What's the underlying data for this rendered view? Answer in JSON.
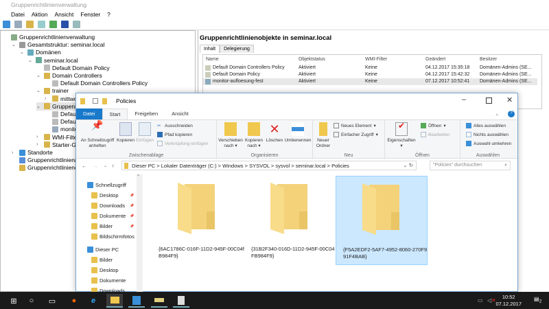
{
  "mmc": {
    "title": "Gruppenrichtlinienverwaltung",
    "menu": [
      "Datei",
      "Aktion",
      "Ansicht",
      "Fenster",
      "?"
    ],
    "tree": [
      {
        "label": "Gruppenrichtlinienverwaltung",
        "level": 0
      },
      {
        "label": "Gesamtstruktur: seminar.local",
        "level": 1
      },
      {
        "label": "Domänen",
        "level": 2
      },
      {
        "label": "seminar.local",
        "level": 3
      },
      {
        "label": "Default Domain Policy",
        "level": 4
      },
      {
        "label": "Domain Controllers",
        "level": 4
      },
      {
        "label": "Default Domain Controllers Policy",
        "level": 5
      },
      {
        "label": "trainer",
        "level": 4
      },
      {
        "label": "mittwoch",
        "level": 5
      },
      {
        "label": "Gruppenrichtlinienobjekte",
        "level": 4
      },
      {
        "label": "Default Domain Controllers Policy",
        "level": 5
      },
      {
        "label": "Default Domain Policy",
        "level": 5
      },
      {
        "label": "monitor-aufloesung-fest",
        "level": 5
      },
      {
        "label": "WMI-Filter",
        "level": 4
      },
      {
        "label": "Starter-Gruppenrichtlinienobjekte",
        "level": 4
      },
      {
        "label": "Standorte",
        "level": 1
      },
      {
        "label": "Gruppenrichtlinienmodellierung",
        "level": 1
      },
      {
        "label": "Gruppenrichtlinienergebnisse",
        "level": 1
      }
    ],
    "panel": {
      "heading": "Gruppenrichtlinienobjekte in seminar.local",
      "tabs": [
        "Inhalt",
        "Delegierung"
      ],
      "columns": [
        "Name",
        "Objektstatus",
        "WMI-Filter",
        "Geändert",
        "Besitzer"
      ],
      "rows": [
        [
          "Default Domain Controllers Policy",
          "Aktiviert",
          "Keine",
          "04.12.2017 15:35:18",
          "Domänen-Admins (SE..."
        ],
        [
          "Default Domain Policy",
          "Aktiviert",
          "Keine",
          "04.12.2017 15:42:32",
          "Domänen-Admins (SE..."
        ],
        [
          "monitor-aufloesung-fest",
          "Aktiviert",
          "Keine",
          "07.12.2017 10:52:41",
          "Domänen-Admins (SE..."
        ]
      ]
    }
  },
  "explorer": {
    "title": "Policies",
    "tabs": [
      "Datei",
      "Start",
      "Freigeben",
      "Ansicht"
    ],
    "ribbon": {
      "pin": "An Schnellzugriff anheften",
      "copy": "Kopieren",
      "paste": "Einfügen",
      "cut": "Ausschneiden",
      "copy_path": "Pfad kopieren",
      "paste_link": "Verknüpfung einfügen",
      "clipboard": "Zwischenablage",
      "move": "Verschieben nach",
      "copyto": "Kopieren nach",
      "delete": "Löschen",
      "rename": "Umbenennen",
      "organize": "Organisieren",
      "new_folder": "Neuer Ordner",
      "new_item": "Neues Element",
      "easy_access": "Einfacher Zugriff",
      "new": "Neu",
      "properties": "Eigenschaften",
      "open": "Öffnen",
      "edit": "Bearbeiten",
      "open_group": "Öffnen",
      "select_all": "Alles auswählen",
      "select_none": "Nichts auswählen",
      "invert": "Auswahl umkehren",
      "select": "Auswählen"
    },
    "breadcrumb_text": "Dieser PC  >  Lokaler Datenträger (C:)  >  Windows  >  SYSVOL  >  sysvol  >  seminar.local  >  Policies",
    "search_placeholder": "\"Policies\" durchsuchen",
    "nav": {
      "quick": "Schnellzugriff",
      "quick_items": [
        "Desktop",
        "Downloads",
        "Dokumente",
        "Bilder",
        "Bildschirmfotos"
      ],
      "pc": "Dieser PC",
      "pc_items": [
        "Bilder",
        "Desktop",
        "Dokumente",
        "Downloads"
      ]
    },
    "folders": [
      "{6AC1786C-016F-11D2-945F-00C04fB984F9}",
      "{31B2F340-016D-11D2-945F-00C04FB984F9}",
      "{F5A2EDF2-5AF7-4952-8060-270F991F4BAB}"
    ]
  },
  "taskbar": {
    "time": "10:52",
    "date": "07.12.2017",
    "notifications": "2"
  }
}
